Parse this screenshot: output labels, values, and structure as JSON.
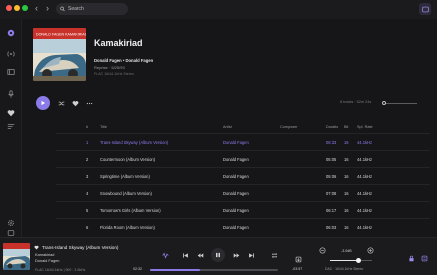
{
  "window": {
    "search_placeholder": "Search"
  },
  "album": {
    "title": "Kamakiriad",
    "artists": "Donald Fagen • Donald Fagen",
    "label_year": "Reprise  ·  5/25/93",
    "format": "FLAC 16/44.1kHz Stereo",
    "cover_text": "DONALD FAGEN  KAMAKIRIAD"
  },
  "list_info": "8 tracks · 52m 24s",
  "columns": {
    "num": "#",
    "title": "Title",
    "artist": "Artist",
    "composer": "Composer",
    "duration": "Duratio",
    "bit": "Bit",
    "rate": "Spl. Rate"
  },
  "tracks": [
    {
      "num": "1",
      "title": "Trans-Island Skyway (Album Version)",
      "artist": "Donald Fagen",
      "composer": "",
      "duration": "06:33",
      "bit": "16",
      "rate": "44.1kHz",
      "active": true
    },
    {
      "num": "2",
      "title": "Countermoon (Album Version)",
      "artist": "Donald Fagen",
      "composer": "",
      "duration": "05:05",
      "bit": "16",
      "rate": "44.1kHz",
      "active": false
    },
    {
      "num": "3",
      "title": "Springtime (Album Version)",
      "artist": "Donald Fagen",
      "composer": "",
      "duration": "05:06",
      "bit": "16",
      "rate": "44.1kHz",
      "active": false
    },
    {
      "num": "4",
      "title": "Snowbound (Album Version)",
      "artist": "Donald Fagen",
      "composer": "",
      "duration": "07:08",
      "bit": "16",
      "rate": "44.1kHz",
      "active": false
    },
    {
      "num": "5",
      "title": "Tomorrow's Girls (Album Version)",
      "artist": "Donald Fagen",
      "composer": "",
      "duration": "06:17",
      "bit": "16",
      "rate": "44.1kHz",
      "active": false
    },
    {
      "num": "6",
      "title": "Florida Room (Album Version)",
      "artist": "Donald Fagen",
      "composer": "",
      "duration": "06:03",
      "bit": "16",
      "rate": "44.1kHz",
      "active": false
    }
  ],
  "player": {
    "title": "Trans-Island Skyway (Album Version)",
    "album": "Kamakiriad",
    "artist": "Donald Fagen",
    "format": "FLAC 16/44.1kHz | 900 · 2.0kHz",
    "elapsed": "02:32",
    "remaining": "-03:57",
    "progress": 0.39,
    "volume_label": "-3.0dB",
    "volume": 0.68,
    "output": "DAC · 16/44.1kHz Stereo"
  },
  "colors": {
    "accent": "#8b7be8",
    "background": "#161618"
  }
}
